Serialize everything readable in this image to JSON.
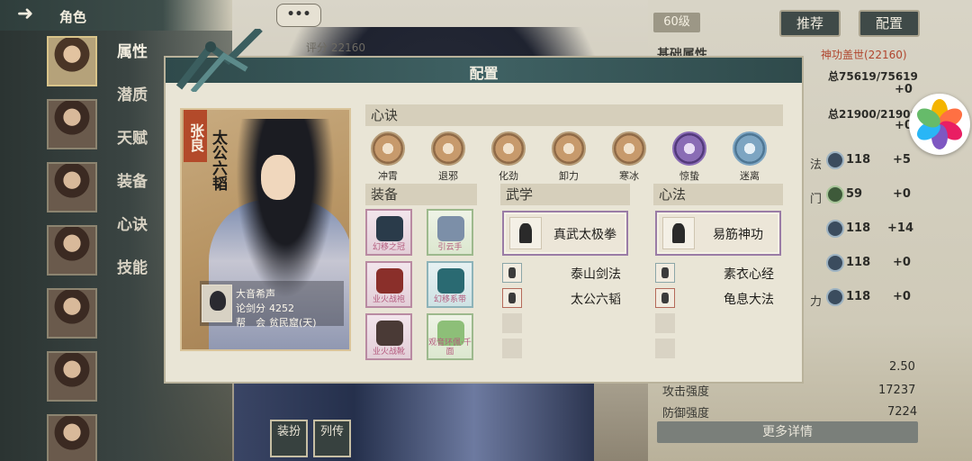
{
  "nav": {
    "back_icon": "arrow-left-icon",
    "title": "角色",
    "menu": [
      "属性",
      "潜质",
      "天赋",
      "装备",
      "心诀",
      "技能"
    ]
  },
  "scene": {
    "chat_label": "•••",
    "score_label": "评分 22160"
  },
  "right": {
    "level": "60级",
    "recommend_label": "推荐",
    "config_label": "配置",
    "section_title": "基础属性",
    "power_label": "神功盖世(22160)",
    "total1": "总75619/75619",
    "plus1": "+0",
    "total2": "总21900/21900",
    "plus2": "+0",
    "stats": [
      {
        "name": "法",
        "value": "118",
        "bonus": "+5"
      },
      {
        "name": "门",
        "value": "59",
        "bonus": "+0"
      },
      {
        "name": "",
        "value": "118",
        "bonus": "+14"
      },
      {
        "name": "",
        "value": "118",
        "bonus": "+0"
      },
      {
        "name": "力",
        "value": "118",
        "bonus": "+0"
      }
    ],
    "val_250": "2.50",
    "attack_label": "攻击强度",
    "attack_value": "17237",
    "defense_label": "防御强度",
    "defense_value": "7224",
    "more_label": "更多详情"
  },
  "bottom_buttons": [
    {
      "label": "装扮"
    },
    {
      "label": "列传"
    }
  ],
  "modal": {
    "title": "配置",
    "character": {
      "name": "张良",
      "title": "太公六韬",
      "player_name": "大音希声",
      "score_label": "论剑分",
      "score_value": "4252",
      "guild_label": "帮　会",
      "guild_value": "贫民窟(天)"
    },
    "xinjue": {
      "header": "心诀",
      "items": [
        "冲霄",
        "退邪",
        "化劲",
        "卸力",
        "寒冰",
        "惊蛰",
        "迷离"
      ]
    },
    "equipment": {
      "header": "装备",
      "items": [
        "幻移之冠",
        "引云手",
        "业火战袍",
        "幻移系带",
        "业火战靴",
        "观音环佩·千面"
      ]
    },
    "martial": {
      "header": "武学",
      "main": "真武太极拳",
      "subs": [
        "泰山剑法",
        "太公六韬"
      ]
    },
    "heart": {
      "header": "心法",
      "main": "易筋神功",
      "subs": [
        "素衣心经",
        "龟息大法"
      ]
    }
  }
}
